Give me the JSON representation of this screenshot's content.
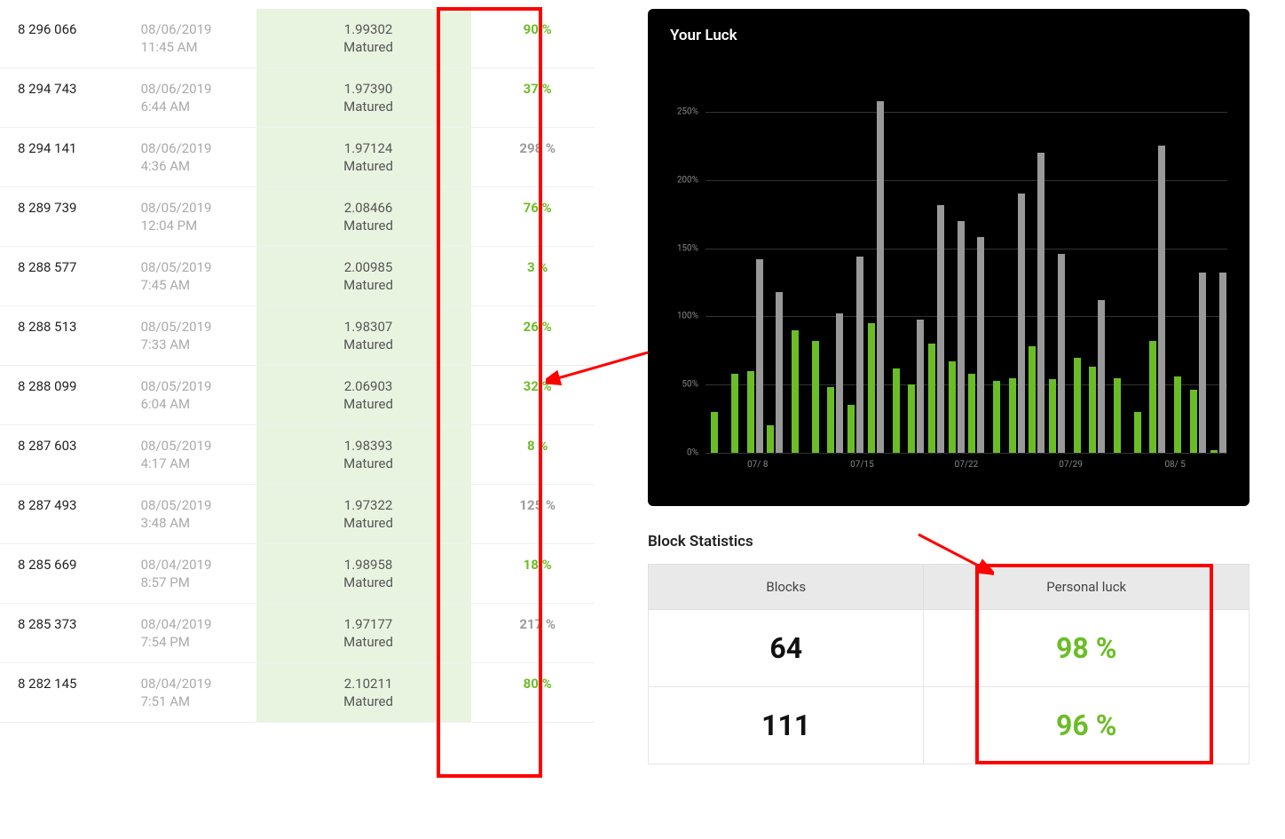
{
  "table": {
    "matured_label": "Matured",
    "rows": [
      {
        "block": "8 296 066",
        "date": "08/06/2019",
        "time": "11:45 AM",
        "reward": "1.99302",
        "pct": "90 %",
        "pct_class": "green"
      },
      {
        "block": "8 294 743",
        "date": "08/06/2019",
        "time": "6:44 AM",
        "reward": "1.97390",
        "pct": "37 %",
        "pct_class": "green"
      },
      {
        "block": "8 294 141",
        "date": "08/06/2019",
        "time": "4:36 AM",
        "reward": "1.97124",
        "pct": "298 %",
        "pct_class": "gray"
      },
      {
        "block": "8 289 739",
        "date": "08/05/2019",
        "time": "12:04 PM",
        "reward": "2.08466",
        "pct": "76 %",
        "pct_class": "green"
      },
      {
        "block": "8 288 577",
        "date": "08/05/2019",
        "time": "7:45 AM",
        "reward": "2.00985",
        "pct": "3 %",
        "pct_class": "green"
      },
      {
        "block": "8 288 513",
        "date": "08/05/2019",
        "time": "7:33 AM",
        "reward": "1.98307",
        "pct": "26 %",
        "pct_class": "green"
      },
      {
        "block": "8 288 099",
        "date": "08/05/2019",
        "time": "6:04 AM",
        "reward": "2.06903",
        "pct": "32 %",
        "pct_class": "green"
      },
      {
        "block": "8 287 603",
        "date": "08/05/2019",
        "time": "4:17 AM",
        "reward": "1.98393",
        "pct": "8 %",
        "pct_class": "green"
      },
      {
        "block": "8 287 493",
        "date": "08/05/2019",
        "time": "3:48 AM",
        "reward": "1.97322",
        "pct": "125 %",
        "pct_class": "gray"
      },
      {
        "block": "8 285 669",
        "date": "08/04/2019",
        "time": "8:57 PM",
        "reward": "1.98958",
        "pct": "18 %",
        "pct_class": "green"
      },
      {
        "block": "8 285 373",
        "date": "08/04/2019",
        "time": "7:54 PM",
        "reward": "1.97177",
        "pct": "217 %",
        "pct_class": "gray"
      },
      {
        "block": "8 282 145",
        "date": "08/04/2019",
        "time": "7:51 AM",
        "reward": "2.10211",
        "pct": "80 %",
        "pct_class": "green"
      }
    ]
  },
  "chart_data": {
    "type": "bar",
    "title": "Your Luck",
    "ylim": [
      0,
      280
    ],
    "y_ticks": [
      "0%",
      "50%",
      "100%",
      "150%",
      "200%",
      "250%"
    ],
    "x_ticks": [
      "07/ 8",
      "07/15",
      "07/22",
      "07/29",
      "08/ 5"
    ],
    "series": [
      {
        "name": "green",
        "values": [
          30,
          58,
          60,
          20,
          90,
          82,
          48,
          35,
          95,
          62,
          50,
          80,
          67,
          58,
          53,
          55,
          78,
          54,
          70,
          63,
          55,
          30,
          82,
          56,
          46,
          2
        ]
      },
      {
        "name": "gray",
        "values": [
          0,
          0,
          142,
          118,
          0,
          0,
          102,
          144,
          258,
          0,
          98,
          182,
          170,
          158,
          0,
          190,
          220,
          146,
          0,
          112,
          0,
          0,
          225,
          0,
          132,
          132
        ]
      }
    ],
    "xlabel": "",
    "ylabel": ""
  },
  "stats": {
    "title": "Block Statistics",
    "header_blocks": "Blocks",
    "header_luck": "Personal luck",
    "rows": [
      {
        "blocks": "64",
        "luck": "98 %"
      },
      {
        "blocks": "111",
        "luck": "96 %"
      }
    ]
  }
}
